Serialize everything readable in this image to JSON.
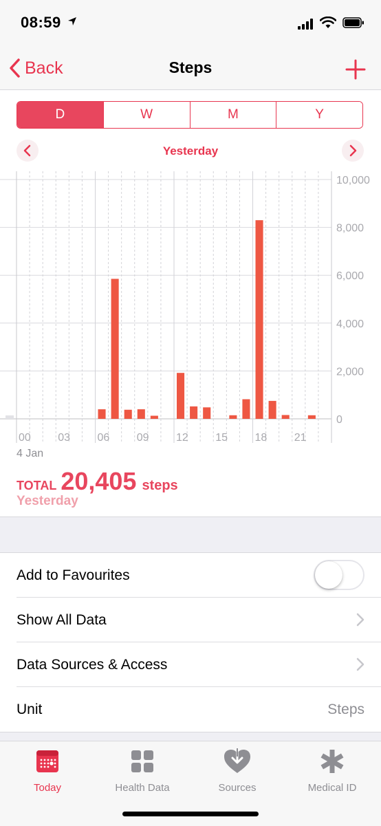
{
  "status_bar": {
    "time": "08:59"
  },
  "nav": {
    "back_label": "Back",
    "title": "Steps"
  },
  "segments": [
    "D",
    "W",
    "M",
    "Y"
  ],
  "selected_segment": "D",
  "date_label": "Yesterday",
  "chart_data": {
    "type": "bar",
    "x_labels": [
      "00",
      "03",
      "06",
      "09",
      "12",
      "15",
      "18",
      "21"
    ],
    "hours": [
      0,
      1,
      2,
      3,
      4,
      5,
      6,
      7,
      8,
      9,
      10,
      11,
      12,
      13,
      14,
      15,
      16,
      17,
      18,
      19,
      20,
      21,
      22,
      23
    ],
    "values": [
      0,
      0,
      0,
      0,
      0,
      0,
      400,
      5850,
      380,
      400,
      130,
      0,
      1920,
      520,
      480,
      0,
      150,
      820,
      8300,
      750,
      160,
      0,
      150,
      0
    ],
    "y_ticks": [
      "10,000",
      "8,000",
      "6,000",
      "4,000",
      "2,000",
      "0"
    ],
    "ylim": [
      0,
      10000
    ],
    "date_caption": "4 Jan",
    "bar_color": "#ee5743"
  },
  "summary": {
    "total_label": "TOTAL",
    "total_value": "20,405",
    "unit": "steps",
    "period": "Yesterday"
  },
  "settings": {
    "favourites": "Add to Favourites",
    "favourites_on": false,
    "show_all": "Show All Data",
    "sources": "Data Sources & Access",
    "unit_label": "Unit",
    "unit_value": "Steps"
  },
  "tabs": [
    {
      "label": "Today",
      "icon": "calendar-icon",
      "active": true
    },
    {
      "label": "Health Data",
      "icon": "grid-icon",
      "active": false
    },
    {
      "label": "Sources",
      "icon": "heart-download-icon",
      "active": false
    },
    {
      "label": "Medical ID",
      "icon": "asterisk-icon",
      "active": false
    }
  ],
  "accent_color": "#e8354f"
}
